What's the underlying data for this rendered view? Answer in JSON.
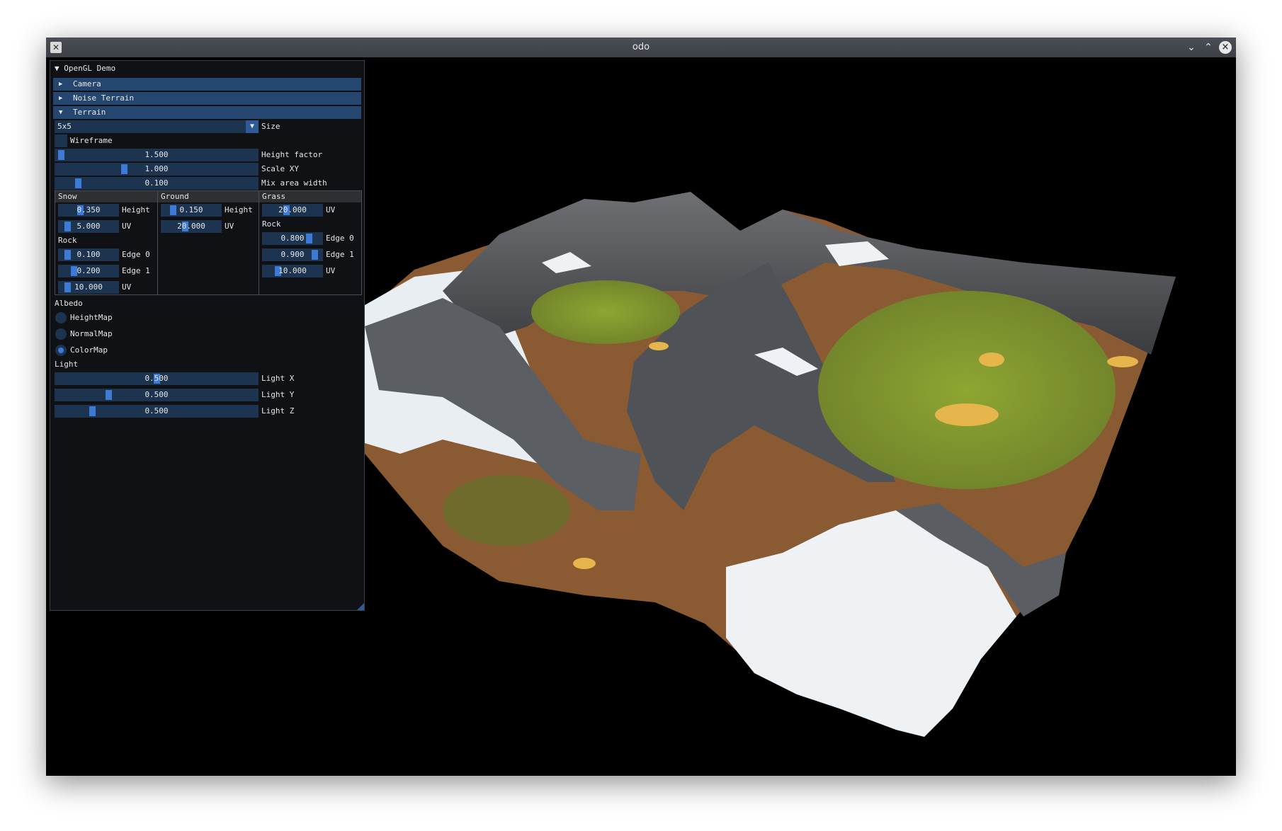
{
  "window": {
    "title": "odo"
  },
  "panel": {
    "title": "OpenGL Demo",
    "headers": [
      {
        "label": "Camera",
        "open": false
      },
      {
        "label": "Noise Terrain",
        "open": false
      },
      {
        "label": "Terrain",
        "open": true
      }
    ],
    "size": {
      "value": "5x5",
      "label": "Size"
    },
    "wireframe": {
      "label": "Wireframe",
      "checked": false
    },
    "sliders": [
      {
        "value": "1.500",
        "label": "Height factor"
      },
      {
        "value": "1.000",
        "label": "Scale XY"
      },
      {
        "value": "0.100",
        "label": "Mix area width"
      }
    ],
    "table": {
      "columns": [
        "Snow",
        "Ground",
        "Grass"
      ],
      "snow": {
        "height": {
          "value": "0.350",
          "label": "Height"
        },
        "uv": {
          "value": "5.000",
          "label": "UV"
        },
        "rock_label": "Rock",
        "edge0": {
          "value": "0.100",
          "label": "Edge 0"
        },
        "edge1": {
          "value": "0.200",
          "label": "Edge 1"
        },
        "rock_uv": {
          "value": "10.000",
          "label": "UV"
        }
      },
      "ground": {
        "height": {
          "value": "0.150",
          "label": "Height"
        },
        "uv": {
          "value": "20.000",
          "label": "UV"
        }
      },
      "grass": {
        "uv": {
          "value": "20.000",
          "label": "UV"
        },
        "rock_label": "Rock",
        "edge0": {
          "value": "0.800",
          "label": "Edge 0"
        },
        "edge1": {
          "value": "0.900",
          "label": "Edge 1"
        },
        "rock_uv": {
          "value": "10.000",
          "label": "UV"
        }
      }
    },
    "albedo": {
      "label": "Albedo",
      "options": [
        "HeightMap",
        "NormalMap",
        "ColorMap"
      ],
      "selected": "ColorMap"
    },
    "light": {
      "label": "Light",
      "sliders": [
        {
          "value": "0.500",
          "label": "Light X"
        },
        {
          "value": "0.500",
          "label": "Light Y"
        },
        {
          "value": "0.500",
          "label": "Light Z"
        }
      ]
    }
  },
  "colors": {
    "accent": "#3d7ad6",
    "frame_bg": "#1d3450",
    "header_bg": "#24466f",
    "snow": "#eef2f5",
    "rock": "#55585c",
    "ground": "#8a5a32",
    "grass": "#7f9a2e",
    "sand": "#e6b64c"
  }
}
